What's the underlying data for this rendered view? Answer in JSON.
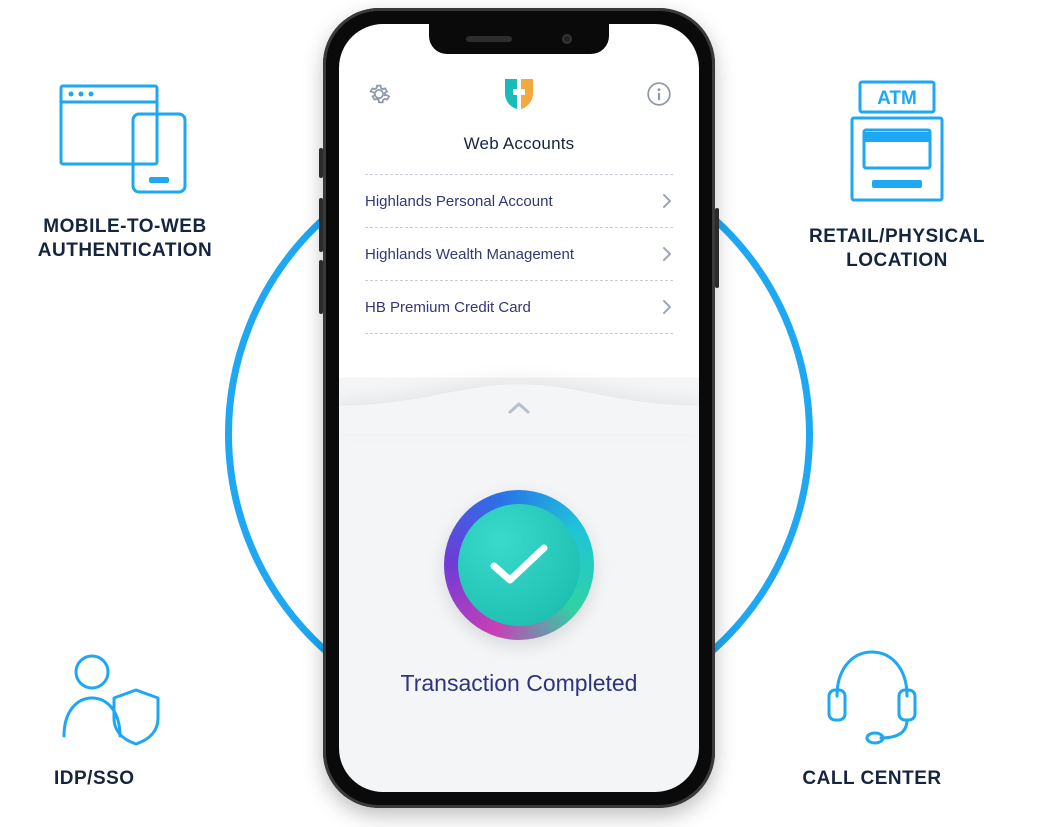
{
  "diagram": {
    "pods": {
      "top_left": "MOBILE-TO-WEB AUTHENTICATION",
      "top_right": "RETAIL/PHYSICAL LOCATION",
      "bottom_left": "IDP/SSO",
      "bottom_right": "CALL CENTER",
      "atm_label": "ATM"
    }
  },
  "phone": {
    "section_title": "Web Accounts",
    "accounts": [
      "Highlands Personal Account",
      "Highlands Wealth Management",
      "HB Premium Credit Card"
    ],
    "status": "Transaction Completed"
  }
}
